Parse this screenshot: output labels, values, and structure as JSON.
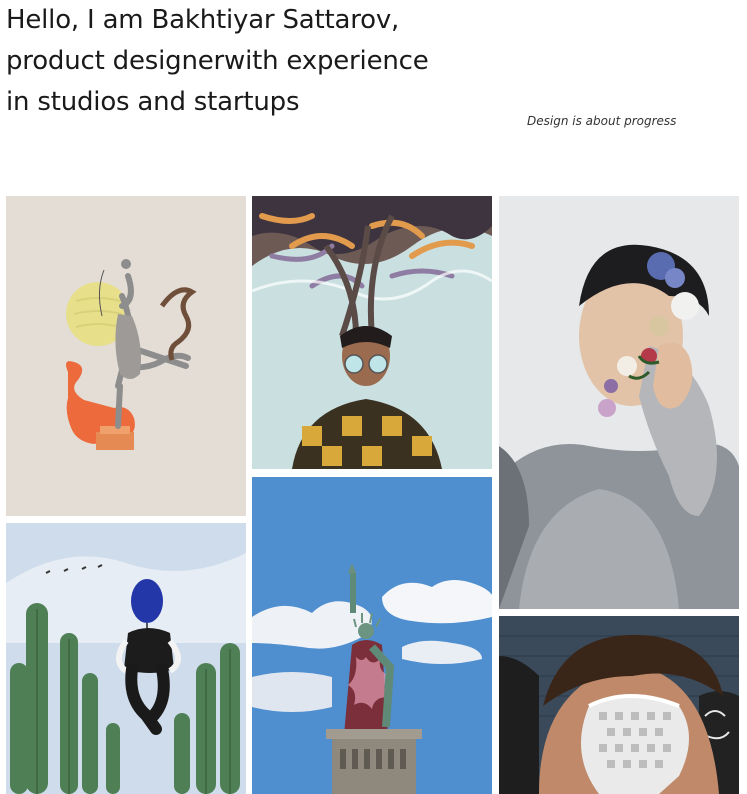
{
  "hero": {
    "lines": [
      "Hello, I am Bakhtiyar Sattarov,",
      "product designerwith experience",
      "in studios and startups"
    ]
  },
  "tagline": "Design is about progress",
  "gallery": {
    "items": [
      {
        "name": "dancer-collage"
      },
      {
        "name": "smoke-hair-portrait"
      },
      {
        "name": "flower-face-portrait"
      },
      {
        "name": "balloon-cactus"
      },
      {
        "name": "statue-of-liberty"
      },
      {
        "name": "masked-portrait"
      }
    ]
  }
}
